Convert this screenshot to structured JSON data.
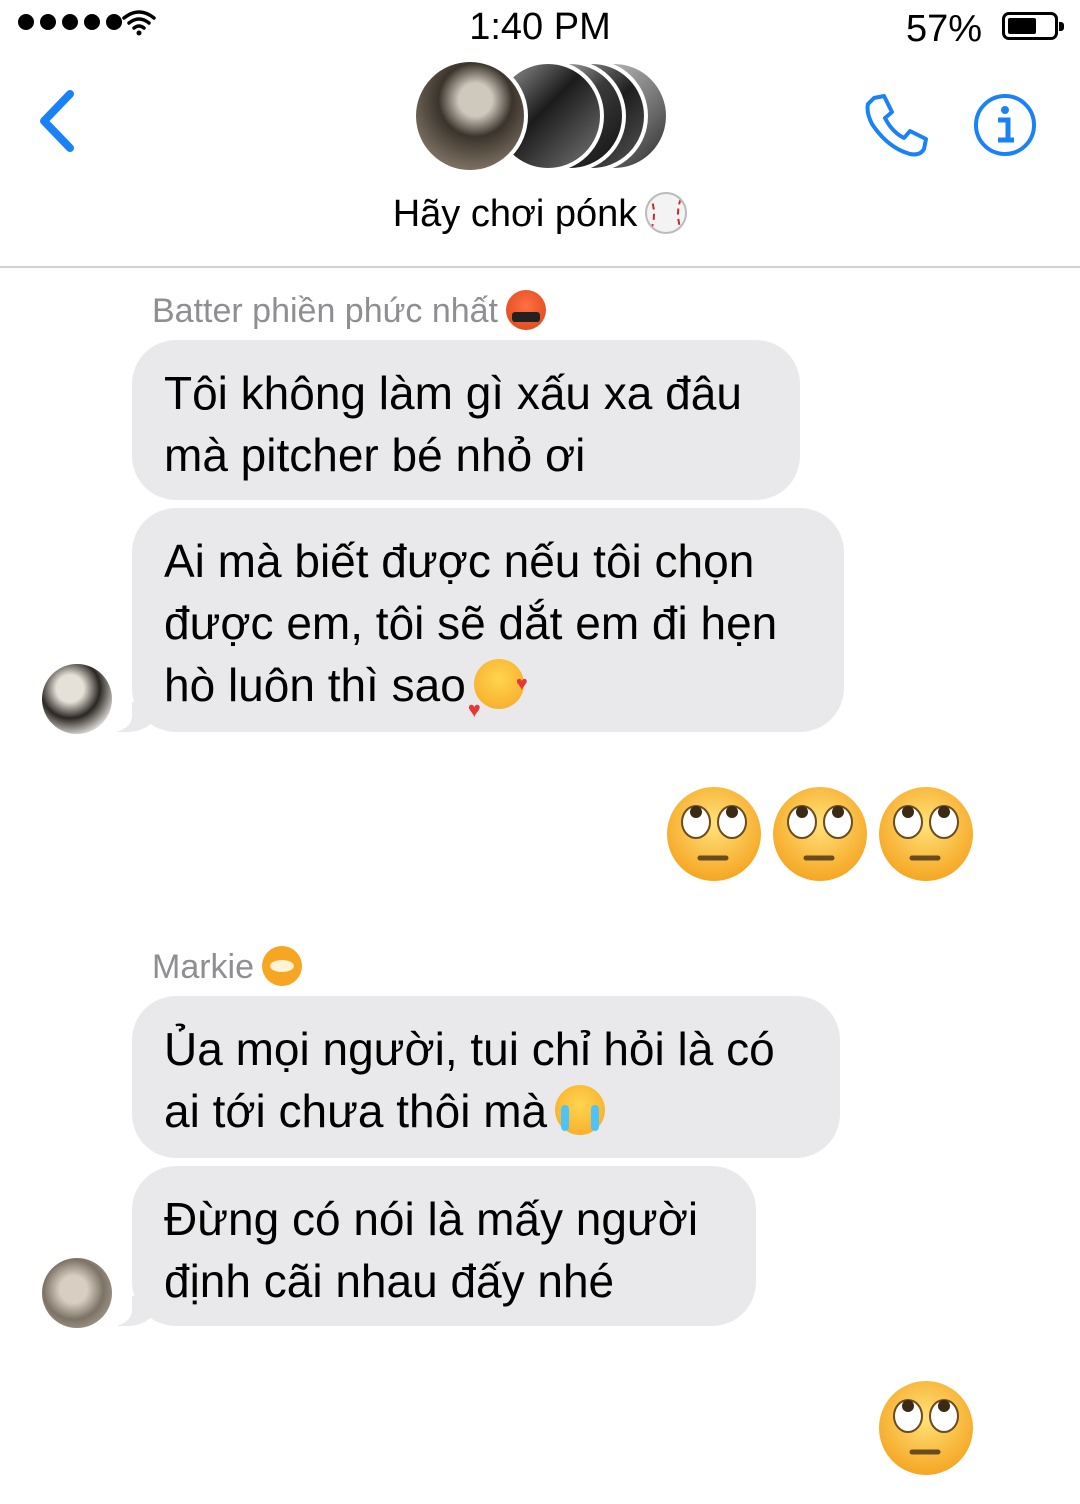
{
  "status_bar": {
    "time": "1:40 PM",
    "battery_percent": "57%",
    "battery_level": 0.57,
    "signal_bars": 5
  },
  "header": {
    "group_name": "Hãy chơi pónk",
    "group_emoji": "baseball",
    "back_icon": "chevron-left-icon",
    "call_icon": "phone-icon",
    "info_icon": "info-icon",
    "accent_color": "#1a82f7"
  },
  "messages": [
    {
      "sender": "Batter phiền phức nhất",
      "sender_emoji": "face-with-symbols-on-mouth",
      "bubbles": [
        {
          "lines": [
            "Tôi không làm gì xấu xa đâu",
            "mà pitcher bé nhỏ ơi"
          ]
        },
        {
          "lines": [
            "Ai mà biết được nếu tôi chọn",
            "được em, tôi sẽ dắt em đi hẹn",
            "hò luôn thì sao"
          ],
          "emoji": "smiling-face-with-hearts"
        }
      ]
    },
    {
      "from_me": true,
      "emoji_only": [
        "face-with-rolling-eyes",
        "face-with-rolling-eyes",
        "face-with-rolling-eyes"
      ]
    },
    {
      "sender": "Markie",
      "sender_emoji": "tiger-face",
      "bubbles": [
        {
          "lines": [
            "Ủa mọi người, tui chỉ hỏi là có",
            "ai tới chưa thôi mà"
          ],
          "emoji": "loudly-crying-face"
        },
        {
          "lines": [
            "Đừng có nói là mấy người",
            "định cãi nhau đấy nhé"
          ]
        }
      ]
    },
    {
      "from_me": true,
      "emoji_only": [
        "face-with-rolling-eyes"
      ]
    }
  ],
  "colors": {
    "bubble_gray": "#e9e9eb",
    "sender_gray": "#8e8e93",
    "ios_blue": "#1a82f7"
  }
}
